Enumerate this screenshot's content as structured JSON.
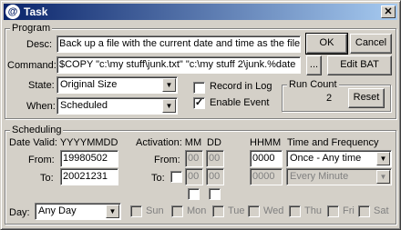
{
  "title": "Task",
  "program": {
    "group_label": "Program",
    "desc_label": "Desc:",
    "desc_value": "Back up a file with the current date and time as the filen",
    "command_label": "Command:",
    "command_value": "$COPY \"c:\\my stuff\\junk.txt\" \"c:\\my stuff 2\\junk.%date",
    "browse_label": "...",
    "ok_label": "OK",
    "cancel_label": "Cancel",
    "edit_bat_label": "Edit BAT",
    "state_label": "State:",
    "state_value": "Original Size",
    "when_label": "When:",
    "when_value": "Scheduled",
    "record_label": "Record in Log",
    "enable_label": "Enable Event",
    "record_checked": false,
    "enable_checked": true,
    "run_count_label": "Run Count",
    "run_count_value": "2",
    "reset_label": "Reset"
  },
  "scheduling": {
    "group_label": "Scheduling",
    "date_valid_label": "Date Valid: YYYYMMDD",
    "from_label": "From:",
    "from_value": "19980502",
    "to_label": "To:",
    "to_value": "20021231",
    "activation_label": "Activation: MM",
    "dd_label": "DD",
    "hhmm_label": "HHMM",
    "time_freq_label": "Time and Frequency",
    "act_from_label": "From:",
    "act_to_label": "To:",
    "act_from_mm": "00",
    "act_from_dd": "00",
    "act_from_hhmm": "0000",
    "act_to_mm": "00",
    "act_to_dd": "00",
    "act_to_hhmm": "0000",
    "freq1_value": "Once - Any time",
    "freq2_value": "Every Minute",
    "day_label": "Day:",
    "day_value": "Any Day",
    "days": [
      "Sun",
      "Mon",
      "Tue",
      "Wed",
      "Thu",
      "Fri",
      "Sat"
    ]
  },
  "icons": {
    "title_icon": "@",
    "close_icon": "✕",
    "dropdown_icon": "▼",
    "check_mark": "✓"
  }
}
